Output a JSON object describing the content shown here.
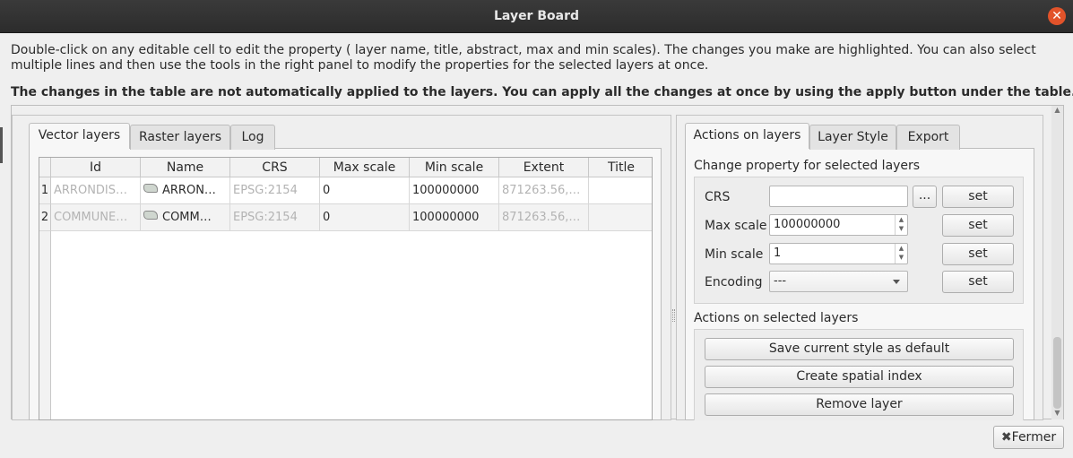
{
  "window": {
    "title": "Layer Board",
    "close_icon": "close-icon"
  },
  "intro_text": "Double-click on any editable cell to edit the property ( layer name, title, abstract, max and min scales). The changes you make are highlighted. You can also select multiple lines and then use the tools in the right panel to modify the properties for the selected layers at once.",
  "warning_text": "The changes in the table are not automatically applied to the layers. You can apply all the changes at once by using the apply button under the table.",
  "left_tabs": [
    "Vector layers",
    "Raster layers",
    "Log"
  ],
  "table": {
    "columns": [
      "Id",
      "Name",
      "CRS",
      "Max scale",
      "Min scale",
      "Extent",
      "Title"
    ],
    "rows": [
      {
        "num": "1",
        "id": "ARRONDIS…",
        "name": "ARRON…",
        "crs": "EPSG:2154",
        "max_scale": "0",
        "min_scale": "100000000",
        "extent": "871263.56,…",
        "title": ""
      },
      {
        "num": "2",
        "id": "COMMUNE…",
        "name": "COMM…",
        "crs": "EPSG:2154",
        "max_scale": "0",
        "min_scale": "100000000",
        "extent": "871263.56,…",
        "title": ""
      }
    ]
  },
  "right_tabs": [
    "Actions on layers",
    "Layer Style",
    "Export"
  ],
  "change_property": {
    "title": "Change property for selected layers",
    "crs_label": "CRS",
    "crs_value": "",
    "browse_label": "...",
    "max_scale_label": "Max scale",
    "max_scale_value": "100000000",
    "min_scale_label": "Min scale",
    "min_scale_value": "1",
    "encoding_label": "Encoding",
    "encoding_value": "---",
    "set_label": "set"
  },
  "actions": {
    "title": "Actions on selected layers",
    "save_style": "Save current style as default",
    "spatial_index": "Create spatial index",
    "remove_layer": "Remove layer"
  },
  "footer": {
    "close_label": "Fermer",
    "close_icon": "x-icon"
  }
}
